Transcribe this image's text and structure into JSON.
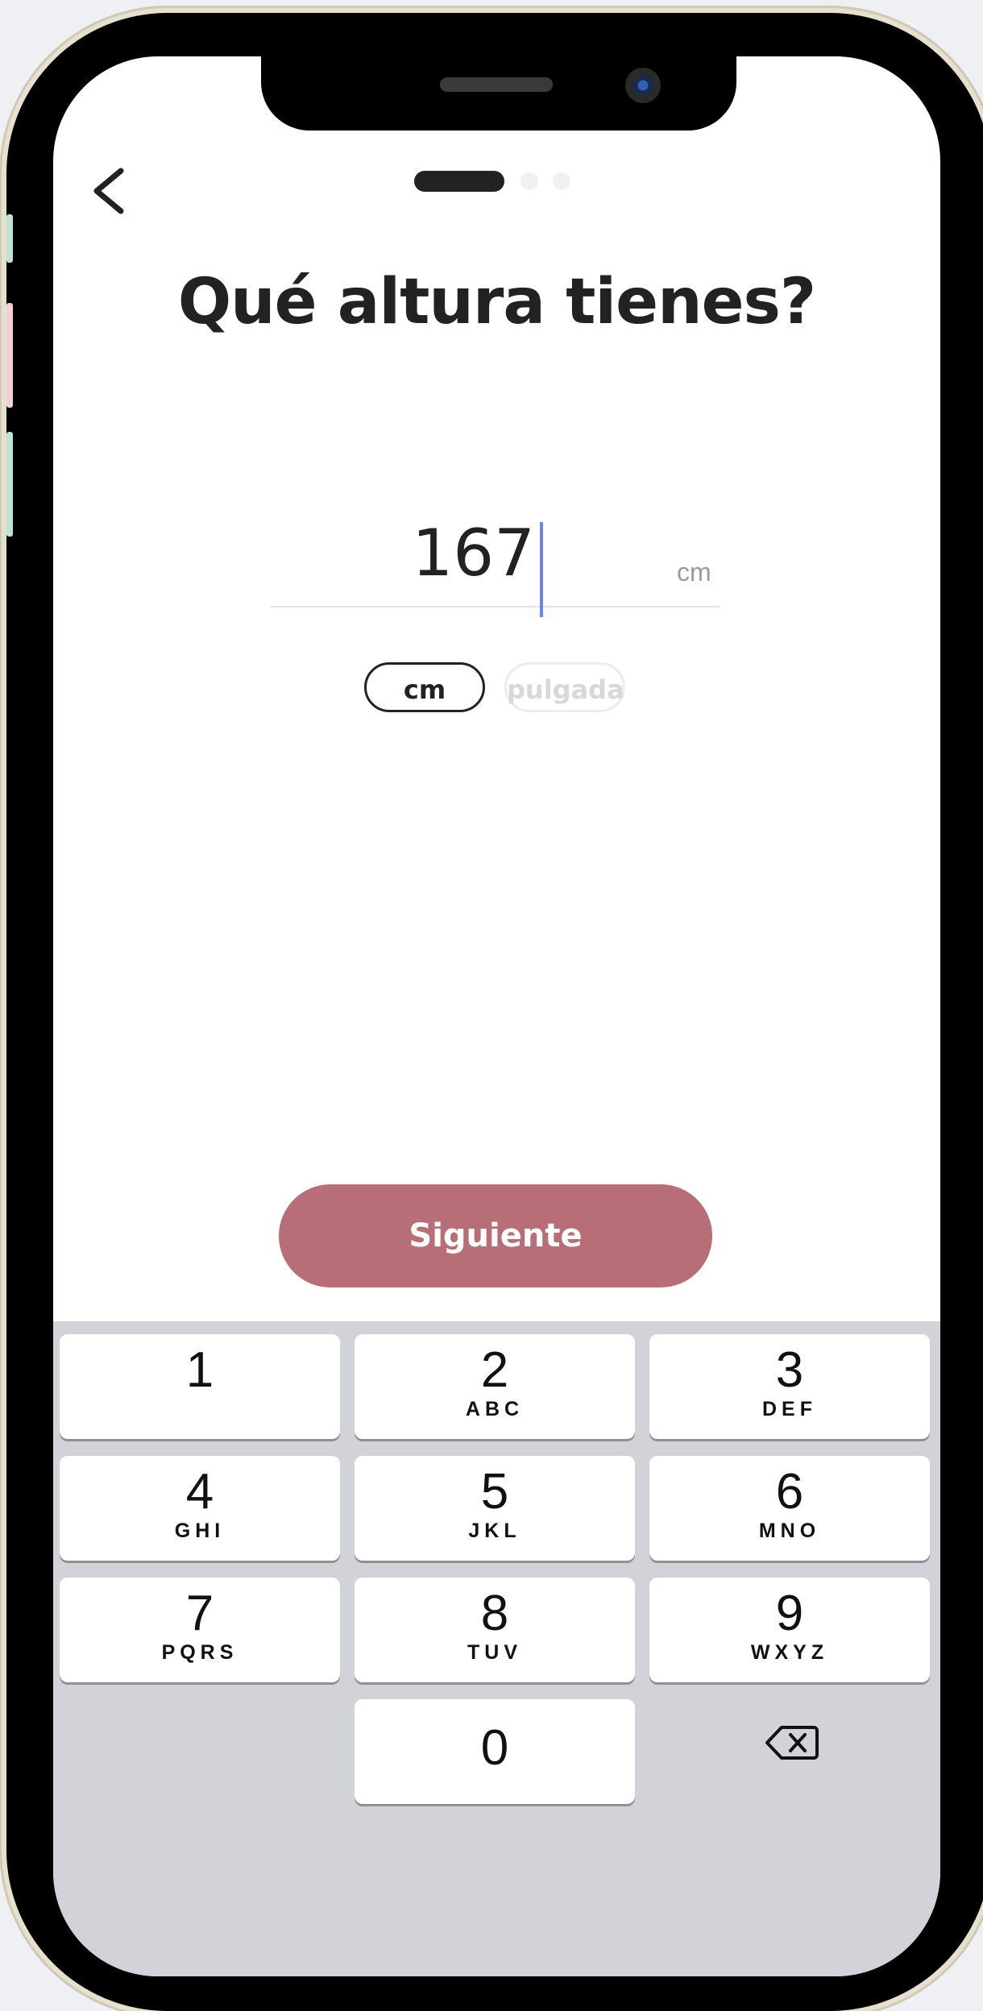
{
  "header": {
    "back_icon": "chevron-left-icon",
    "progress": {
      "total_steps": 3,
      "current_step": 1
    }
  },
  "title": "Qué altura tienes?",
  "height_input": {
    "value": "167",
    "unit": "cm"
  },
  "unit_toggle": {
    "options": [
      "cm",
      "pulgada"
    ],
    "selected": "cm"
  },
  "next_button": {
    "label": "Siguiente"
  },
  "keyboard": {
    "keys": [
      {
        "num": "1",
        "letters": ""
      },
      {
        "num": "2",
        "letters": "ABC"
      },
      {
        "num": "3",
        "letters": "DEF"
      },
      {
        "num": "4",
        "letters": "GHI"
      },
      {
        "num": "5",
        "letters": "JKL"
      },
      {
        "num": "6",
        "letters": "MNO"
      },
      {
        "num": "7",
        "letters": "PQRS"
      },
      {
        "num": "8",
        "letters": "TUV"
      },
      {
        "num": "9",
        "letters": "WXYZ"
      },
      {
        "num": "0",
        "letters": ""
      }
    ],
    "delete_icon": "backspace-icon"
  },
  "colors": {
    "accent": "#b76e76",
    "caret": "#6d86d6",
    "keyboard_bg": "#d1d3d9"
  }
}
